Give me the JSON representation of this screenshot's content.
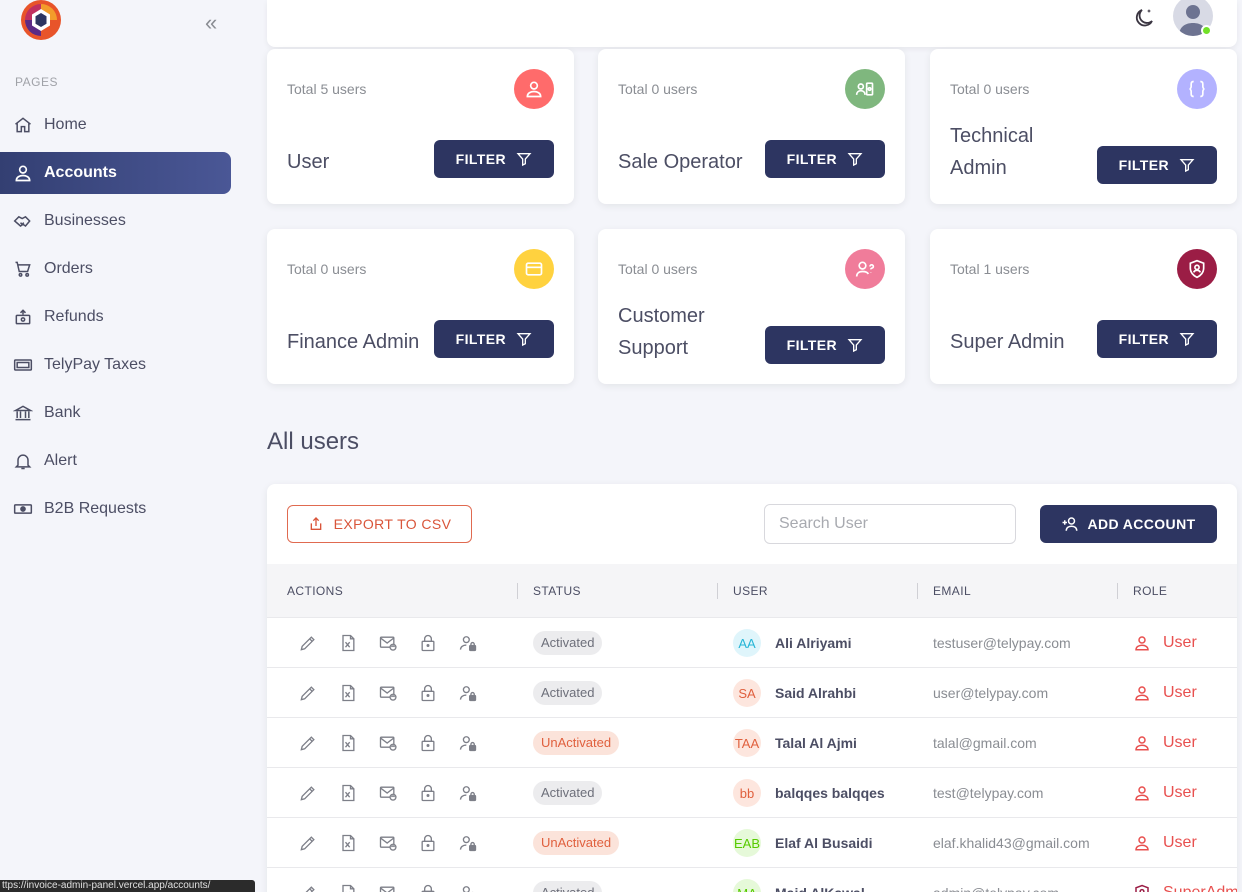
{
  "sidebar": {
    "section_title": "PAGES",
    "items": [
      {
        "label": "Home",
        "icon": "home-icon"
      },
      {
        "label": "Accounts",
        "icon": "account-icon"
      },
      {
        "label": "Businesses",
        "icon": "handshake-icon"
      },
      {
        "label": "Orders",
        "icon": "cart-icon"
      },
      {
        "label": "Refunds",
        "icon": "refund-icon"
      },
      {
        "label": "TelyPay Taxes",
        "icon": "tax-icon"
      },
      {
        "label": "Bank",
        "icon": "bank-icon"
      },
      {
        "label": "Alert",
        "icon": "bell-icon"
      },
      {
        "label": "B2B Requests",
        "icon": "cash-icon"
      }
    ]
  },
  "roles": [
    {
      "total": "Total 5 users",
      "name": "User",
      "color": "#ff6b6b"
    },
    {
      "total": "Total 0 users",
      "name": "Sale Operator",
      "color": "#7fb77e"
    },
    {
      "total": "Total 0 users",
      "name": "Technical Admin",
      "color": "#b3b2ff"
    },
    {
      "total": "Total 0 users",
      "name": "Finance Admin",
      "color": "#ffd23f"
    },
    {
      "total": "Total 0 users",
      "name": "Customer Support",
      "color": "#f07c9a"
    },
    {
      "total": "Total 1 users",
      "name": "Super Admin",
      "color": "#9b1d45"
    }
  ],
  "filter_label": "FILTER",
  "all_users_heading": "All users",
  "toolbar": {
    "export_label": "EXPORT TO CSV",
    "search_placeholder": "Search User",
    "add_label": "ADD ACCOUNT"
  },
  "table": {
    "headers": [
      "ACTIONS",
      "STATUS",
      "USER",
      "EMAIL",
      "ROLE"
    ],
    "rows": [
      {
        "status": "Activated",
        "initials": "AA",
        "name": "Ali Alriyami",
        "email": "testuser@telypay.com",
        "role": "User"
      },
      {
        "status": "Activated",
        "initials": "SA",
        "name": "Said Alrahbi",
        "email": "user@telypay.com",
        "role": "User"
      },
      {
        "status": "UnActivated",
        "initials": "TAA",
        "name": "Talal Al Ajmi",
        "email": "talal@gmail.com",
        "role": "User"
      },
      {
        "status": "Activated",
        "initials": "bb",
        "name": "balqqes balqqes",
        "email": "test@telypay.com",
        "role": "User"
      },
      {
        "status": "UnActivated",
        "initials": "EAB",
        "name": "Elaf Al Busaidi",
        "email": "elaf.khalid43@gmail.com",
        "role": "User"
      },
      {
        "status": "Activated",
        "initials": "MA",
        "name": "Majd AlKawal",
        "email": "admin@telypay.com",
        "role": "SuperAdmin"
      }
    ]
  },
  "status_bar_url": "ttps://invoice-admin-panel.vercel.app/accounts/"
}
